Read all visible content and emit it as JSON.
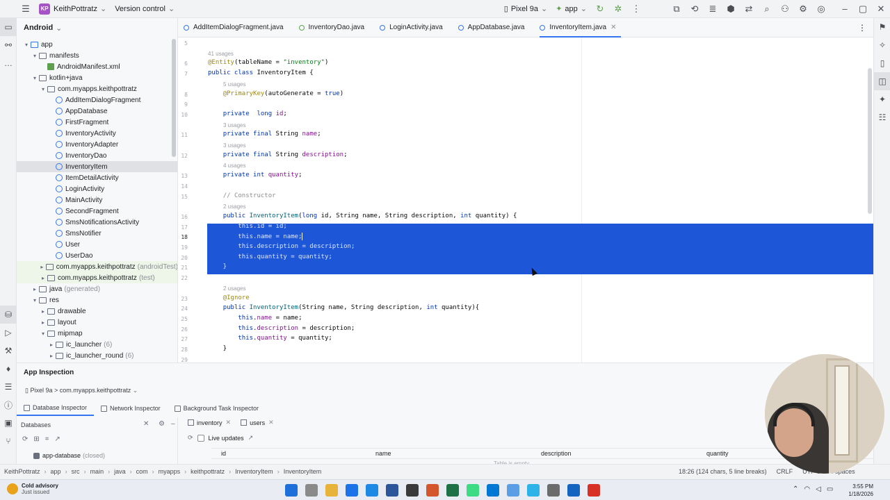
{
  "titlebar": {
    "project_badge": "KP",
    "project_name": "KeithPottratz",
    "vcs": "Version control",
    "device": "Pixel 9a",
    "run_config": "app"
  },
  "left_stripe": {
    "icons": [
      "folder-icon",
      "structure-icon",
      "more-icon",
      "device-icon",
      "run-icon",
      "build-icon",
      "inspection-icon",
      "logcat-icon",
      "problems-icon",
      "terminal-icon",
      "git-icon"
    ]
  },
  "project": {
    "view_selector": "Android",
    "tree": [
      {
        "label": "app",
        "kind": "folder-blue",
        "indent": 0,
        "arrow": "▾"
      },
      {
        "label": "manifests",
        "kind": "folder",
        "indent": 1,
        "arrow": "▾"
      },
      {
        "label": "AndroidManifest.xml",
        "kind": "xml",
        "indent": 2,
        "arrow": ""
      },
      {
        "label": "kotlin+java",
        "kind": "folder",
        "indent": 1,
        "arrow": "▾"
      },
      {
        "label": "com.myapps.keithpottratz",
        "kind": "folder",
        "indent": 2,
        "arrow": "▾"
      },
      {
        "label": "AddItemDialogFragment",
        "kind": "class",
        "indent": 3,
        "arrow": ""
      },
      {
        "label": "AppDatabase",
        "kind": "class",
        "indent": 3,
        "arrow": ""
      },
      {
        "label": "FirstFragment",
        "kind": "class",
        "indent": 3,
        "arrow": ""
      },
      {
        "label": "InventoryActivity",
        "kind": "class",
        "indent": 3,
        "arrow": ""
      },
      {
        "label": "InventoryAdapter",
        "kind": "class",
        "indent": 3,
        "arrow": ""
      },
      {
        "label": "InventoryDao",
        "kind": "class",
        "indent": 3,
        "arrow": ""
      },
      {
        "label": "InventoryItem",
        "kind": "class",
        "indent": 3,
        "arrow": "",
        "selected": true
      },
      {
        "label": "ItemDetailActivity",
        "kind": "class",
        "indent": 3,
        "arrow": ""
      },
      {
        "label": "LoginActivity",
        "kind": "class",
        "indent": 3,
        "arrow": ""
      },
      {
        "label": "MainActivity",
        "kind": "class",
        "indent": 3,
        "arrow": ""
      },
      {
        "label": "SecondFragment",
        "kind": "class",
        "indent": 3,
        "arrow": ""
      },
      {
        "label": "SmsNotificationsActivity",
        "kind": "class",
        "indent": 3,
        "arrow": ""
      },
      {
        "label": "SmsNotifier",
        "kind": "class",
        "indent": 3,
        "arrow": ""
      },
      {
        "label": "User",
        "kind": "class",
        "indent": 3,
        "arrow": ""
      },
      {
        "label": "UserDao",
        "kind": "class",
        "indent": 3,
        "arrow": ""
      },
      {
        "label": "com.myapps.keithpottratz",
        "kind": "folder",
        "indent": 2,
        "arrow": "▸",
        "suffix": "(androidTest)",
        "green": true
      },
      {
        "label": "com.myapps.keithpottratz",
        "kind": "folder",
        "indent": 2,
        "arrow": "▸",
        "suffix": "(test)",
        "green": true
      },
      {
        "label": "java",
        "kind": "folder",
        "indent": 1,
        "arrow": "▸",
        "suffix": "(generated)"
      },
      {
        "label": "res",
        "kind": "folder",
        "indent": 1,
        "arrow": "▾"
      },
      {
        "label": "drawable",
        "kind": "folder",
        "indent": 2,
        "arrow": "▸"
      },
      {
        "label": "layout",
        "kind": "folder",
        "indent": 2,
        "arrow": "▸"
      },
      {
        "label": "mipmap",
        "kind": "folder",
        "indent": 2,
        "arrow": "▾"
      },
      {
        "label": "ic_launcher",
        "kind": "folder",
        "indent": 3,
        "arrow": "▸",
        "suffix": "(6)"
      },
      {
        "label": "ic_launcher_round",
        "kind": "folder",
        "indent": 3,
        "arrow": "▸",
        "suffix": "(6)"
      }
    ]
  },
  "tabs": [
    {
      "label": "AddItemDialogFragment.java",
      "active": false
    },
    {
      "label": "InventoryDao.java",
      "active": false,
      "green": true
    },
    {
      "label": "LoginActivity.java",
      "active": false
    },
    {
      "label": "AppDatabase.java",
      "active": false
    },
    {
      "label": "InventoryItem.java",
      "active": true
    }
  ],
  "editor": {
    "lines": [
      {
        "n": "5",
        "usages": "",
        "code": ""
      },
      {
        "n": "",
        "usages": "41 usages",
        "code": ""
      },
      {
        "n": "6",
        "code": "<span class=\"ann\">@Entity</span>(tableName = <span class=\"str\">\"inventory\"</span>)"
      },
      {
        "n": "7",
        "code": "<span class=\"kw\">public class</span> InventoryItem {"
      },
      {
        "n": "",
        "usages": "5 usages",
        "indent": 1
      },
      {
        "n": "8",
        "code": "    <span class=\"ann\">@PrimaryKey</span>(autoGenerate = <span class=\"kw\">true</span>)"
      },
      {
        "n": "9",
        "code": ""
      },
      {
        "n": "10",
        "code": "    <span class=\"kw\">private</span>  <span class=\"kw\">long</span> <span class=\"fld\">id</span>;"
      },
      {
        "n": "",
        "usages": "3 usages",
        "indent": 1
      },
      {
        "n": "11",
        "code": "    <span class=\"kw\">private final</span> String <span class=\"fld\">name</span>;"
      },
      {
        "n": "",
        "usages": "3 usages",
        "indent": 1
      },
      {
        "n": "12",
        "code": "    <span class=\"kw\">private final</span> String <span class=\"fld\">description</span>;"
      },
      {
        "n": "",
        "usages": "4 usages",
        "indent": 1
      },
      {
        "n": "13",
        "code": "    <span class=\"kw\">private int</span> <span class=\"fld\">quantity</span>;"
      },
      {
        "n": "14",
        "code": ""
      },
      {
        "n": "15",
        "code": "    <span class=\"cmt\">// Constructor</span>"
      },
      {
        "n": "",
        "usages": "2 usages",
        "indent": 1
      },
      {
        "n": "16",
        "code": "    <span class=\"kw\">public</span> <span class=\"mth\">InventoryItem</span>(<span class=\"kw\">long</span> id, String name, String description, <span class=\"kw\">int</span> quantity) {"
      },
      {
        "n": "17",
        "code": "        this.id = id;",
        "sel": true
      },
      {
        "n": "18",
        "code": "        this.name = name;",
        "sel": true,
        "caret": true,
        "cur": true
      },
      {
        "n": "19",
        "code": "        this.description = description;",
        "sel": true
      },
      {
        "n": "20",
        "code": "        this.quantity = quantity;",
        "sel": true
      },
      {
        "n": "21",
        "code": "    }",
        "sel": true
      },
      {
        "n": "22",
        "code": ""
      },
      {
        "n": "",
        "usages": "2 usages",
        "indent": 1
      },
      {
        "n": "23",
        "code": "    <span class=\"ann\">@Ignore</span>"
      },
      {
        "n": "24",
        "code": "    <span class=\"kw\">public</span> <span class=\"mth\">InventoryItem</span>(String name, String description, <span class=\"kw\">int</span> quantity){"
      },
      {
        "n": "25",
        "code": "        <span class=\"kw\">this</span>.<span class=\"fld\">name</span> = name;"
      },
      {
        "n": "26",
        "code": "        <span class=\"kw\">this</span>.<span class=\"fld\">description</span> = description;"
      },
      {
        "n": "27",
        "code": "        <span class=\"kw\">this</span>.<span class=\"fld\">quantity</span> = quantity;"
      },
      {
        "n": "28",
        "code": "    }"
      },
      {
        "n": "29",
        "code": ""
      }
    ]
  },
  "inspection": {
    "title": "App Inspection",
    "device_path": "Pixel 9a > com.myapps.keithpottratz",
    "tabs": [
      "Database Inspector",
      "Network Inspector",
      "Background Task Inspector"
    ],
    "databases_label": "Databases",
    "database_item": "app-database",
    "database_state": "(closed)",
    "table_tabs": [
      "inventory",
      "users"
    ],
    "live_updates": "Live updates",
    "columns": [
      "id",
      "name",
      "description",
      "quantity"
    ],
    "empty_text": "Table is empty"
  },
  "statusbar": {
    "crumbs": [
      "KeithPottratz",
      "app",
      "src",
      "main",
      "java",
      "com",
      "myapps",
      "keithpottratz",
      "InventoryItem",
      "InventoryItem"
    ],
    "position": "18:26 (124 chars, 5 line breaks)",
    "line_sep": "CRLF",
    "encoding": "UTF-8",
    "indent": "4 spaces"
  },
  "taskbar": {
    "weather_title": "Cold advisory",
    "weather_sub": "Just issued",
    "time": "3:55 PM",
    "date": "1/18/2026",
    "app_colors": [
      "#1e6fd9",
      "#8a8a8a",
      "#e8b33a",
      "#1a73e8",
      "#1e88e5",
      "#2b579a",
      "#3a3a3a",
      "#d4562c",
      "#1e7145",
      "#3ddc84",
      "#0078d4",
      "#5c9ee5",
      "#2db3e8",
      "#6b6b6b",
      "#1565c0",
      "#d93025"
    ]
  }
}
